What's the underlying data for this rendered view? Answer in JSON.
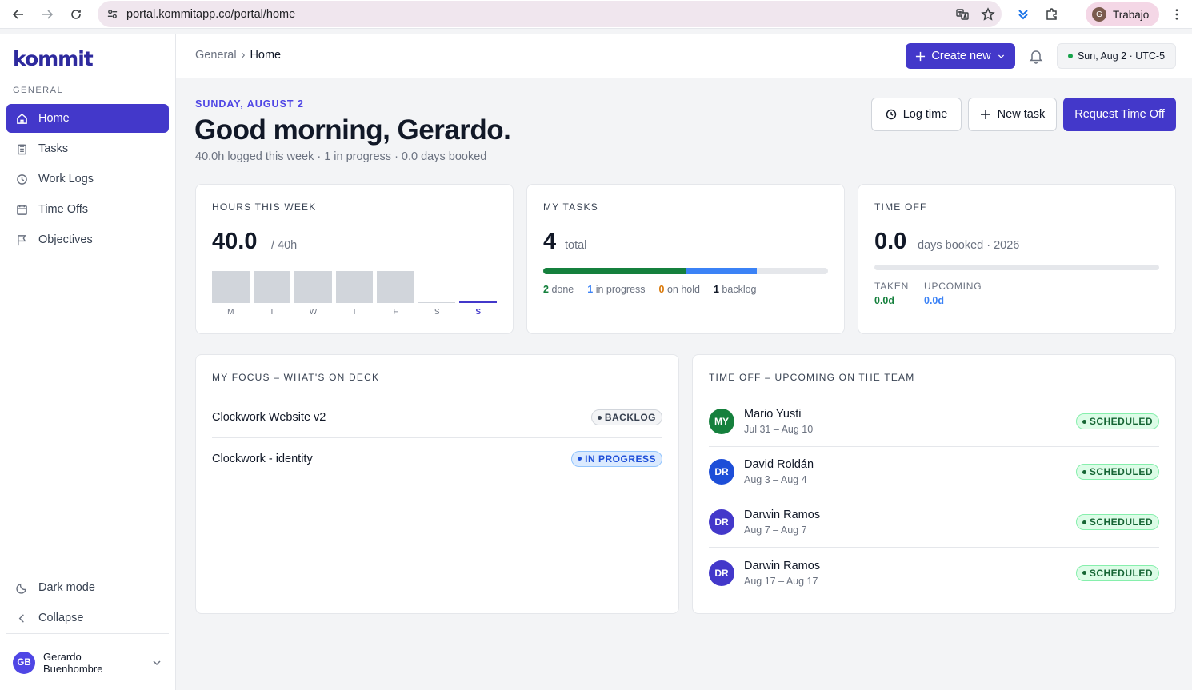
{
  "browser": {
    "url": "portal.kommitapp.co/portal/home",
    "profile_initial": "G",
    "profile_name": "Trabajo"
  },
  "sidebar": {
    "logo": "kommit",
    "section_label": "GENERAL",
    "items": [
      {
        "label": "Home",
        "icon": "home-icon",
        "active": true
      },
      {
        "label": "Tasks",
        "icon": "clipboard-icon"
      },
      {
        "label": "Work Logs",
        "icon": "clock-icon"
      },
      {
        "label": "Time Offs",
        "icon": "calendar-icon"
      },
      {
        "label": "Objectives",
        "icon": "flag-icon"
      }
    ],
    "dark_mode_label": "Dark mode",
    "collapse_label": "Collapse",
    "user": {
      "initials": "GB",
      "name": "Gerardo Buenhombre"
    }
  },
  "topbar": {
    "breadcrumb_parent": "General",
    "breadcrumb_separator": "›",
    "breadcrumb_current": "Home",
    "create_label": "Create new",
    "date_chip": "Sun, Aug 2 · UTC-5"
  },
  "header": {
    "date_kicker": "SUNDAY, AUGUST 2",
    "greeting": "Good morning, Gerardo.",
    "summary": "40.0h logged this week · 1 in progress · 0.0 days booked",
    "log_time_label": "Log time",
    "new_task_label": "New task",
    "request_label": "Request Time Off"
  },
  "hours_card": {
    "title": "HOURS THIS WEEK",
    "value": "40.0",
    "target": "/ 40h",
    "days": [
      {
        "label": "M",
        "fill": 1.0
      },
      {
        "label": "T",
        "fill": 1.0
      },
      {
        "label": "W",
        "fill": 1.0
      },
      {
        "label": "T",
        "fill": 1.0
      },
      {
        "label": "F",
        "fill": 1.0
      },
      {
        "label": "S",
        "fill": 0.0
      },
      {
        "label": "S",
        "fill": 0.0,
        "today": true
      }
    ]
  },
  "tasks_card": {
    "title": "MY TASKS",
    "value": "4",
    "unit": "total",
    "done": "2",
    "done_label": "done",
    "in_progress": "1",
    "in_progress_label": "in progress",
    "on_hold": "0",
    "on_hold_label": "on hold",
    "backlog": "1",
    "backlog_label": "backlog",
    "colors": {
      "done": "#15803d",
      "in_progress": "#3b82f6",
      "on_hold": "#d97706",
      "backlog": "#111827"
    }
  },
  "timeoff_card": {
    "title": "TIME OFF",
    "value": "0.0",
    "unit": "days booked · 2026",
    "taken_label": "TAKEN",
    "taken_value": "0.0d",
    "upcoming_label": "UPCOMING",
    "upcoming_value": "0.0d"
  },
  "focus_card": {
    "title": "MY FOCUS – WHAT'S ON DECK",
    "items": [
      {
        "name": "Clockwork Website v2",
        "status": "BACKLOG",
        "kind": "backlog"
      },
      {
        "name": "Clockwork - identity",
        "status": "IN PROGRESS",
        "kind": "inprog"
      }
    ]
  },
  "team_card": {
    "title": "TIME OFF – UPCOMING ON THE TEAM",
    "items": [
      {
        "initials": "MY",
        "name": "Mario Yusti",
        "dates": "Jul 31 – Aug 10",
        "status": "SCHEDULED",
        "color": "#15803d"
      },
      {
        "initials": "DR",
        "name": "David Roldán",
        "dates": "Aug 3 – Aug 4",
        "status": "SCHEDULED",
        "color": "#1d4ed8"
      },
      {
        "initials": "DR",
        "name": "Darwin Ramos",
        "dates": "Aug 7 – Aug 7",
        "status": "SCHEDULED",
        "color": "#4338ca"
      },
      {
        "initials": "DR",
        "name": "Darwin Ramos",
        "dates": "Aug 17 – Aug 17",
        "status": "SCHEDULED",
        "color": "#4338ca"
      }
    ]
  }
}
